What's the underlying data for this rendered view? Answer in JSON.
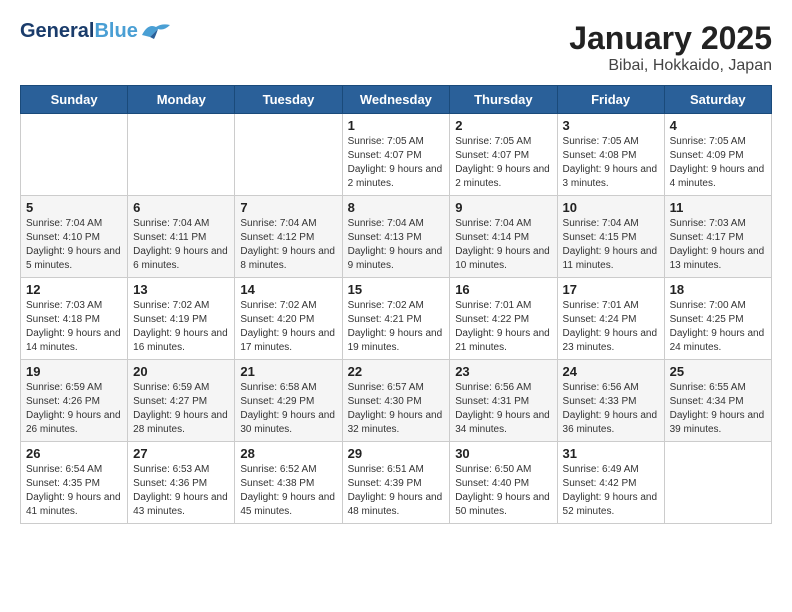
{
  "logo": {
    "general": "General",
    "blue": "Blue"
  },
  "title": "January 2025",
  "subtitle": "Bibai, Hokkaido, Japan",
  "days_of_week": [
    "Sunday",
    "Monday",
    "Tuesday",
    "Wednesday",
    "Thursday",
    "Friday",
    "Saturday"
  ],
  "weeks": [
    [
      {
        "day": "",
        "info": ""
      },
      {
        "day": "",
        "info": ""
      },
      {
        "day": "",
        "info": ""
      },
      {
        "day": "1",
        "info": "Sunrise: 7:05 AM\nSunset: 4:07 PM\nDaylight: 9 hours and 2 minutes."
      },
      {
        "day": "2",
        "info": "Sunrise: 7:05 AM\nSunset: 4:07 PM\nDaylight: 9 hours and 2 minutes."
      },
      {
        "day": "3",
        "info": "Sunrise: 7:05 AM\nSunset: 4:08 PM\nDaylight: 9 hours and 3 minutes."
      },
      {
        "day": "4",
        "info": "Sunrise: 7:05 AM\nSunset: 4:09 PM\nDaylight: 9 hours and 4 minutes."
      }
    ],
    [
      {
        "day": "5",
        "info": "Sunrise: 7:04 AM\nSunset: 4:10 PM\nDaylight: 9 hours and 5 minutes."
      },
      {
        "day": "6",
        "info": "Sunrise: 7:04 AM\nSunset: 4:11 PM\nDaylight: 9 hours and 6 minutes."
      },
      {
        "day": "7",
        "info": "Sunrise: 7:04 AM\nSunset: 4:12 PM\nDaylight: 9 hours and 8 minutes."
      },
      {
        "day": "8",
        "info": "Sunrise: 7:04 AM\nSunset: 4:13 PM\nDaylight: 9 hours and 9 minutes."
      },
      {
        "day": "9",
        "info": "Sunrise: 7:04 AM\nSunset: 4:14 PM\nDaylight: 9 hours and 10 minutes."
      },
      {
        "day": "10",
        "info": "Sunrise: 7:04 AM\nSunset: 4:15 PM\nDaylight: 9 hours and 11 minutes."
      },
      {
        "day": "11",
        "info": "Sunrise: 7:03 AM\nSunset: 4:17 PM\nDaylight: 9 hours and 13 minutes."
      }
    ],
    [
      {
        "day": "12",
        "info": "Sunrise: 7:03 AM\nSunset: 4:18 PM\nDaylight: 9 hours and 14 minutes."
      },
      {
        "day": "13",
        "info": "Sunrise: 7:02 AM\nSunset: 4:19 PM\nDaylight: 9 hours and 16 minutes."
      },
      {
        "day": "14",
        "info": "Sunrise: 7:02 AM\nSunset: 4:20 PM\nDaylight: 9 hours and 17 minutes."
      },
      {
        "day": "15",
        "info": "Sunrise: 7:02 AM\nSunset: 4:21 PM\nDaylight: 9 hours and 19 minutes."
      },
      {
        "day": "16",
        "info": "Sunrise: 7:01 AM\nSunset: 4:22 PM\nDaylight: 9 hours and 21 minutes."
      },
      {
        "day": "17",
        "info": "Sunrise: 7:01 AM\nSunset: 4:24 PM\nDaylight: 9 hours and 23 minutes."
      },
      {
        "day": "18",
        "info": "Sunrise: 7:00 AM\nSunset: 4:25 PM\nDaylight: 9 hours and 24 minutes."
      }
    ],
    [
      {
        "day": "19",
        "info": "Sunrise: 6:59 AM\nSunset: 4:26 PM\nDaylight: 9 hours and 26 minutes."
      },
      {
        "day": "20",
        "info": "Sunrise: 6:59 AM\nSunset: 4:27 PM\nDaylight: 9 hours and 28 minutes."
      },
      {
        "day": "21",
        "info": "Sunrise: 6:58 AM\nSunset: 4:29 PM\nDaylight: 9 hours and 30 minutes."
      },
      {
        "day": "22",
        "info": "Sunrise: 6:57 AM\nSunset: 4:30 PM\nDaylight: 9 hours and 32 minutes."
      },
      {
        "day": "23",
        "info": "Sunrise: 6:56 AM\nSunset: 4:31 PM\nDaylight: 9 hours and 34 minutes."
      },
      {
        "day": "24",
        "info": "Sunrise: 6:56 AM\nSunset: 4:33 PM\nDaylight: 9 hours and 36 minutes."
      },
      {
        "day": "25",
        "info": "Sunrise: 6:55 AM\nSunset: 4:34 PM\nDaylight: 9 hours and 39 minutes."
      }
    ],
    [
      {
        "day": "26",
        "info": "Sunrise: 6:54 AM\nSunset: 4:35 PM\nDaylight: 9 hours and 41 minutes."
      },
      {
        "day": "27",
        "info": "Sunrise: 6:53 AM\nSunset: 4:36 PM\nDaylight: 9 hours and 43 minutes."
      },
      {
        "day": "28",
        "info": "Sunrise: 6:52 AM\nSunset: 4:38 PM\nDaylight: 9 hours and 45 minutes."
      },
      {
        "day": "29",
        "info": "Sunrise: 6:51 AM\nSunset: 4:39 PM\nDaylight: 9 hours and 48 minutes."
      },
      {
        "day": "30",
        "info": "Sunrise: 6:50 AM\nSunset: 4:40 PM\nDaylight: 9 hours and 50 minutes."
      },
      {
        "day": "31",
        "info": "Sunrise: 6:49 AM\nSunset: 4:42 PM\nDaylight: 9 hours and 52 minutes."
      },
      {
        "day": "",
        "info": ""
      }
    ]
  ]
}
